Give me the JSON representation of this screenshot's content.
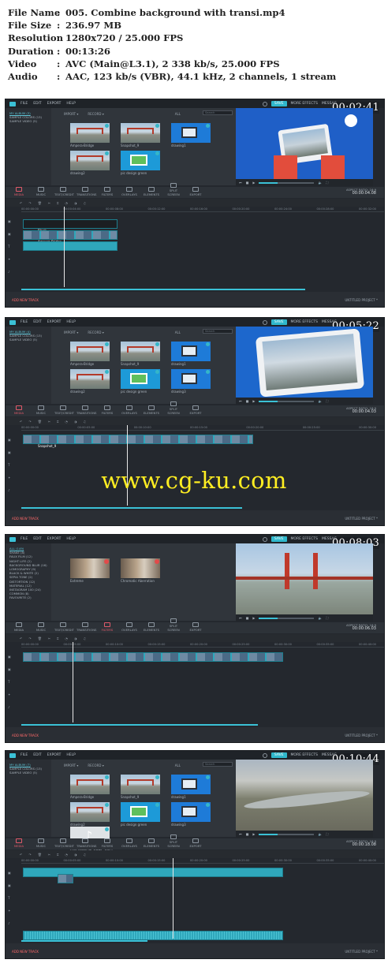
{
  "info": [
    {
      "key": "File Name",
      "value": "005. Combine background with transi.mp4"
    },
    {
      "key": "File Size",
      "value": "236.97 MB"
    },
    {
      "key": "Resolution",
      "value": "1280x720 / 25.000 FPS"
    },
    {
      "key": "Duration",
      "value": "00:13:26"
    },
    {
      "key": "Video",
      "value": "AVC (Main@L3.1), 2 338 kb/s, 25.000 FPS"
    },
    {
      "key": "Audio",
      "value": "AAC, 123 kb/s (VBR), 44.1 kHz, 2 channels, 1 stream"
    }
  ],
  "info_sep": ":",
  "menu": {
    "file": "FILE",
    "edit": "EDIT",
    "export": "EXPORT",
    "help": "HELP",
    "save": "SAVE",
    "more": "MORE EFFECTS",
    "msg": "MESSAG"
  },
  "tabs": [
    "MEDIA",
    "MUSIC",
    "TEXT/CREDIT",
    "TRANSITIONS",
    "FILTERS",
    "OVERLAYS",
    "ELEMENTS",
    "SPLIT SCREEN",
    "EXPORT"
  ],
  "media_toolbar": {
    "import": "IMPORT ▾",
    "record": "RECORD ▾",
    "all": "ALL",
    "search": "Search"
  },
  "add_track": "ADD NEW TRACK",
  "project": "UNTITLED PROJECT *",
  "aspect": "ASPECT RATIO: 16:9",
  "watermark": "www.cg-ku.com",
  "frames": [
    {
      "timecode": "00:02:41",
      "sidebar": [
        "MY ALBUM (3)",
        "SAMPLE COLORS (13)",
        "SAMPLE VIDEO (5)"
      ],
      "tiles": [
        "Ampera-Bridge",
        "Snapshot_9",
        "drawing1",
        "drawing2",
        "pic design green"
      ],
      "preview": "tablet-desk",
      "active_tab": 0,
      "preview_time": "00:00:04.08",
      "ruler": [
        "00:00:00:00",
        "00:00:04:00",
        "00:00:08:00",
        "00:00:12:00",
        "00:00:16:00",
        "00:00:20:00",
        "00:00:24:00",
        "00:00:28:00",
        "00:00:32:00"
      ],
      "clip_labels": [
        "Black",
        "Ampera-Bridge"
      ]
    },
    {
      "timecode": "00:05:22",
      "sidebar": [
        "MY ALBUM (4)",
        "SAMPLE COLORS (13)",
        "SAMPLE VIDEO (5)"
      ],
      "tiles": [
        "Ampera-Bridge",
        "Snapshot_9",
        "drawing1",
        "drawing2",
        "pic design green",
        "drawing3"
      ],
      "preview": "tablet-bridge",
      "active_tab": 0,
      "preview_time": "00:00:04.03",
      "ruler": [
        "00:00:00:00",
        "00:00:05:00",
        "00:00:10:00",
        "00:00:15:00",
        "00:00:20:00",
        "00:00:25:00",
        "00:00:30:00"
      ],
      "clip_labels": [
        "Snapshot_9"
      ]
    },
    {
      "timecode": "00:08:03",
      "sidebar": [
        "ALL (149)",
        "SHAKE (8)",
        "FAUX FILM (12)",
        "NIGHT LIFE (2)",
        "BACKGROUND BLUR (16)",
        "LOMOGRAPHY (9)",
        "BLACK & WHITE (2)",
        "SEPIA TONE (2)",
        "DISTORTION (12)",
        "MATERIAL (12)",
        "INSTAGRAM 100 (24)",
        "COMMON (8)",
        "FAVOURITE (2)"
      ],
      "tiles": [
        "Extreme",
        "Chromatic Aberration"
      ],
      "preview": "bridge",
      "active_tab": 4,
      "preview_time": "00:00:06.03",
      "ruler": [
        "00:00:00:00",
        "00:00:05:00",
        "00:00:10:00",
        "00:00:15:00",
        "00:00:20:00",
        "00:00:25:00",
        "00:00:30:00",
        "00:00:35:00",
        "00:00:40:00"
      ],
      "clip_labels": []
    },
    {
      "timecode": "00:10:44",
      "sidebar": [
        "MY ALBUM (7)",
        "SAMPLE COLORS (13)",
        "SAMPLE VIDEO (5)"
      ],
      "tiles": [
        "Ampera-Bridge",
        "Snapshot_9",
        "drawing1",
        "drawing2",
        "pic design green",
        "drawing3",
        "Free Music for Vlogs - Ele..."
      ],
      "preview": "aerial",
      "active_tab": 0,
      "preview_time": "00:00:18.08",
      "ruler": [
        "00:00:00:00",
        "00:00:05:00",
        "00:00:10:00",
        "00:00:15:00",
        "00:00:20:00",
        "00:00:25:00",
        "00:00:30:00",
        "00:00:35:00",
        "00:00:40:00"
      ],
      "clip_labels": []
    }
  ]
}
